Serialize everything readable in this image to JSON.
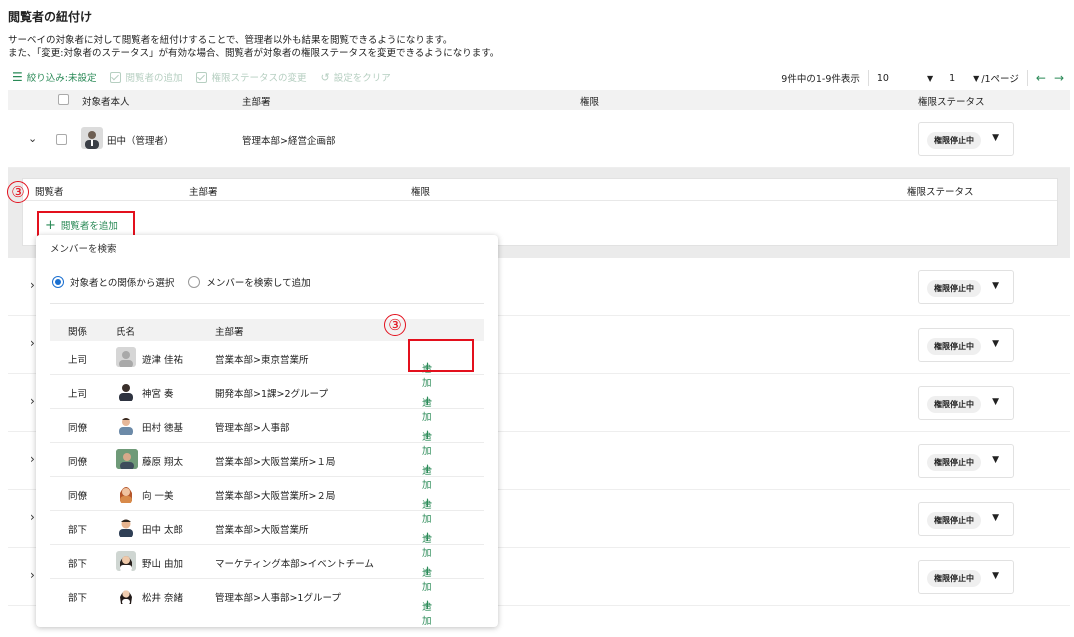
{
  "page": {
    "title": "閲覧者の紐付け",
    "desc1": "サーベイの対象者に対して閲覧者を紐付けすることで、管理者以外も結果を閲覧できるようになります。",
    "desc2": "また、「変更:対象者のステータス」が有効な場合、閲覧者が対象者の権限ステータスを変更できるようになります。"
  },
  "toolbar": {
    "filter": "絞り込み:未設定",
    "add_viewer": "閲覧者の追加",
    "change_status": "権限ステータスの変更",
    "clear": "設定をクリア"
  },
  "pager": {
    "summary": "9件中の1-9件表示",
    "per_page": "10",
    "page": "1",
    "page_total": "/1ページ"
  },
  "table": {
    "headers": {
      "target": "対象者本人",
      "dept": "主部署",
      "perm": "権限",
      "status": "権限ステータス"
    },
    "row1": {
      "name": "田中（管理者）",
      "dept": "管理本部>経営企画部",
      "status": "権限停止中"
    },
    "status_label": "権限停止中"
  },
  "subtable": {
    "headers": {
      "viewer": "閲覧者",
      "dept": "主部署",
      "perm": "権限",
      "status": "権限ステータス"
    },
    "add_viewer": "閲覧者を追加"
  },
  "annotation": {
    "marker": "③"
  },
  "popup": {
    "title": "メンバーを検索",
    "radio1": "対象者との関係から選択",
    "radio2": "メンバーを検索して追加",
    "headers": {
      "relation": "関係",
      "name": "氏名",
      "dept": "主部署"
    },
    "add_label": "追加",
    "rows": [
      {
        "relation": "上司",
        "name": "遊津 佳祐",
        "dept": "営業本部>東京営業所"
      },
      {
        "relation": "上司",
        "name": "神宮 奏",
        "dept": "開発本部>1課>2グループ"
      },
      {
        "relation": "同僚",
        "name": "田村 徳基",
        "dept": "管理本部>人事部"
      },
      {
        "relation": "同僚",
        "name": "藤原 翔太",
        "dept": "営業本部>大阪営業所>１局"
      },
      {
        "relation": "同僚",
        "name": "向 一美",
        "dept": "営業本部>大阪営業所>２局"
      },
      {
        "relation": "部下",
        "name": "田中 太郎",
        "dept": "営業本部>大阪営業所"
      },
      {
        "relation": "部下",
        "name": "野山 由加",
        "dept": "マーケティング本部>イベントチーム"
      },
      {
        "relation": "部下",
        "name": "松井 奈緒",
        "dept": "管理本部>人事部>1グループ"
      }
    ]
  },
  "colors": {
    "accent": "#2a8a57",
    "highlight": "#e3101d",
    "radio": "#1a6fd0"
  }
}
